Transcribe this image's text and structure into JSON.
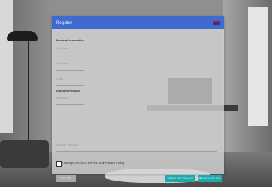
{
  "dialog": {
    "title": "Register"
  },
  "sections": {
    "personal": "Personal Information",
    "login": "Login Information"
  },
  "fields": {
    "first_name": "First name",
    "last_name": "Last name",
    "email": "Email",
    "password": "Password",
    "confirm_password": "Confirm Password"
  },
  "agreement": {
    "label": "I accept Terms of Service and Privacy Policy"
  },
  "buttons": {
    "delete": "Delete",
    "terms": "Terms of Service",
    "privacy": "Privacy Policy"
  },
  "colors": {
    "header": "#3f6bd1",
    "accent": "#1fa9a9"
  }
}
